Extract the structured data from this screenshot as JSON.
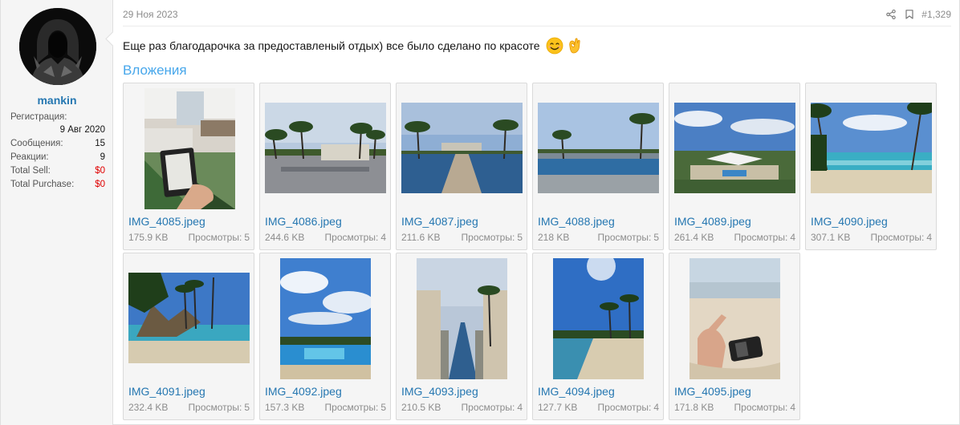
{
  "user": {
    "name": "mankin",
    "stats": [
      {
        "label": "Регистрация:",
        "value": "9 Авг 2020"
      },
      {
        "label": "Сообщения:",
        "value": "15"
      },
      {
        "label": "Реакции:",
        "value": "9"
      },
      {
        "label": "Total Sell:",
        "value": "$0"
      },
      {
        "label": "Total Purchase:",
        "value": "$0"
      }
    ]
  },
  "post": {
    "date": "29 Ноя 2023",
    "number": "#1,329",
    "message": "Еще раз благодарочка за предоставленый отдых) все было сделано по красоте",
    "emoji": [
      "smiling-face-icon",
      "ok-hand-icon"
    ],
    "attachments_title": "Вложения",
    "views_label": "Просмотры:",
    "attachments": [
      {
        "name": "IMG_4085.jpeg",
        "size": "175.9 KB",
        "views": "5"
      },
      {
        "name": "IMG_4086.jpeg",
        "size": "244.6 KB",
        "views": "4"
      },
      {
        "name": "IMG_4087.jpeg",
        "size": "211.6 KB",
        "views": "5"
      },
      {
        "name": "IMG_4088.jpeg",
        "size": "218 KB",
        "views": "5"
      },
      {
        "name": "IMG_4089.jpeg",
        "size": "261.4 KB",
        "views": "4"
      },
      {
        "name": "IMG_4090.jpeg",
        "size": "307.1 KB",
        "views": "4"
      },
      {
        "name": "IMG_4091.jpeg",
        "size": "232.4 KB",
        "views": "5"
      },
      {
        "name": "IMG_4092.jpeg",
        "size": "157.3 KB",
        "views": "5"
      },
      {
        "name": "IMG_4093.jpeg",
        "size": "210.5 KB",
        "views": "4"
      },
      {
        "name": "IMG_4094.jpeg",
        "size": "127.7 KB",
        "views": "4"
      },
      {
        "name": "IMG_4095.jpeg",
        "size": "171.8 KB",
        "views": "4"
      }
    ]
  },
  "colors": {
    "link": "#2577b1",
    "attachments_heading": "#47a7eb",
    "muted": "#8c8c8c",
    "negative": "#e00000"
  }
}
